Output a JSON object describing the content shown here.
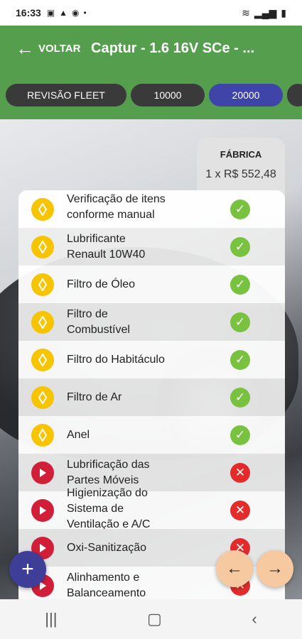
{
  "status": {
    "time": "16:33",
    "left_icons": [
      "image-icon",
      "warning-icon",
      "location-icon",
      "dot-icon"
    ],
    "right_icons": [
      "wifi-icon",
      "signal-icon",
      "battery-icon"
    ]
  },
  "appbar": {
    "back_label": "VOLTAR",
    "title": "Captur - 1.6 16V SCe - ..."
  },
  "chips": [
    {
      "label": "REVISÃO FLEET",
      "active": false
    },
    {
      "label": "10000",
      "active": false
    },
    {
      "label": "20000",
      "active": true
    }
  ],
  "fabrica": {
    "header": "FÁBRICA",
    "price": "1 x R$ 552,48"
  },
  "items": [
    {
      "label": "Verificação de itens conforme manual",
      "icon": "renault-logo-icon",
      "status": "included"
    },
    {
      "label": "Lubrificante Renault 10W40",
      "icon": "renault-logo-icon",
      "status": "included"
    },
    {
      "label": "Filtro de Óleo",
      "icon": "renault-logo-icon",
      "status": "included"
    },
    {
      "label": "Filtro de Combustível",
      "icon": "renault-logo-icon",
      "status": "included"
    },
    {
      "label": "Filtro do Habitáculo",
      "icon": "renault-logo-icon",
      "status": "included"
    },
    {
      "label": "Filtro de Ar",
      "icon": "renault-logo-icon",
      "status": "included"
    },
    {
      "label": "Anel",
      "icon": "renault-logo-icon",
      "status": "included"
    },
    {
      "label": "Lubrificação das Partes Móveis",
      "icon": "play-icon",
      "status": "not-included"
    },
    {
      "label": "Higienização do Sistema de Ventilação e A/C",
      "icon": "play-icon",
      "status": "not-included"
    },
    {
      "label": "Oxi-Sanitização",
      "icon": "play-icon",
      "status": "not-included"
    },
    {
      "label": "Alinhamento e Balanceamento",
      "icon": "play-icon",
      "status": "not-included"
    }
  ],
  "colors": {
    "appbar": "#559e4e",
    "chip": "#3a3a3a",
    "chip_active": "#3f44a8",
    "ok": "#78c23f",
    "no": "#e42b2b",
    "fab_add": "#3e3e98",
    "fab_nav": "#f7c9a1"
  }
}
